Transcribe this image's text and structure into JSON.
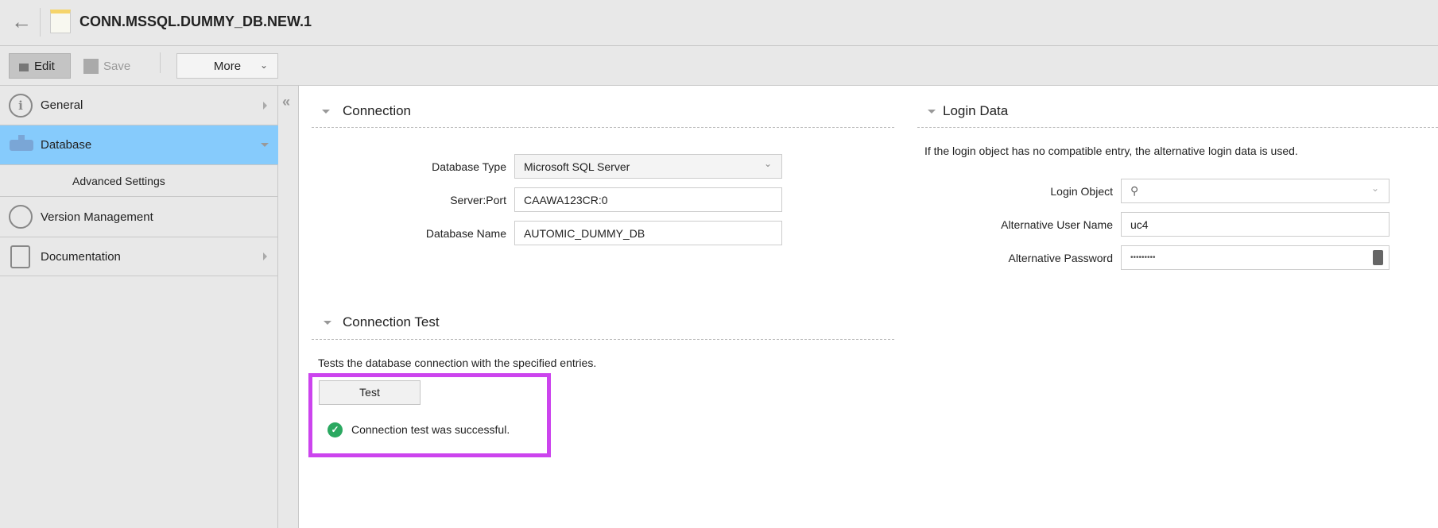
{
  "header": {
    "title": "CONN.MSSQL.DUMMY_DB.NEW.1"
  },
  "toolbar": {
    "edit": "Edit",
    "save": "Save",
    "more": "More"
  },
  "sidebar": {
    "items": [
      {
        "label": "General"
      },
      {
        "label": "Database"
      },
      {
        "label": "Advanced Settings"
      },
      {
        "label": "Version Management"
      },
      {
        "label": "Documentation"
      }
    ]
  },
  "connection": {
    "title": "Connection",
    "fields": [
      {
        "label": "Database Type",
        "value": "Microsoft SQL Server"
      },
      {
        "label": "Server:Port",
        "value": "CAAWA123CR:0"
      },
      {
        "label": "Database Name",
        "value": "AUTOMIC_DUMMY_DB"
      }
    ]
  },
  "login": {
    "title": "Login Data",
    "description": "If the login object has no compatible entry, the alternative login data is used.",
    "fields": [
      {
        "label": "Login Object",
        "value": ""
      },
      {
        "label": "Alternative User Name",
        "value": "uc4"
      },
      {
        "label": "Alternative Password",
        "value": "•••••••••"
      }
    ]
  },
  "test": {
    "title": "Connection Test",
    "description": "Tests the database connection with the specified entries.",
    "button": "Test",
    "result": "Connection test was successful."
  },
  "colors": {
    "selected": "#86cbfc",
    "highlight": "#cc44ee",
    "success": "#2aa860"
  }
}
